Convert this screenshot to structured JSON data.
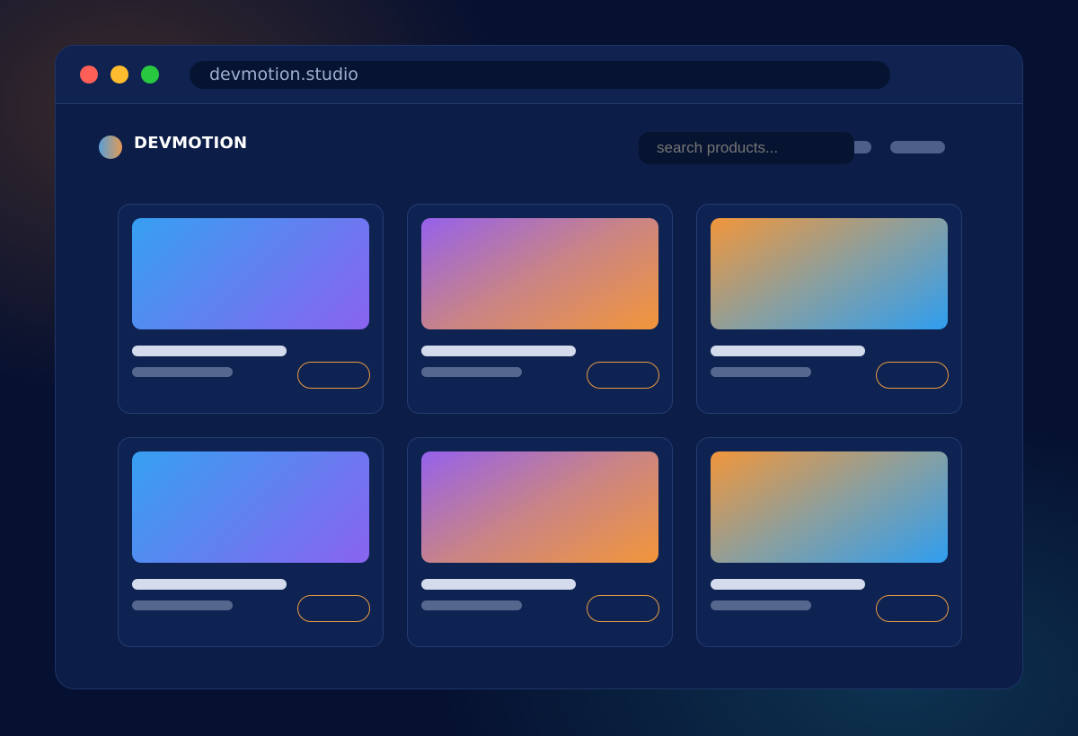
{
  "browser": {
    "url": "devmotion.studio",
    "traffic_lights": {
      "close": "#ff5f57",
      "minimize": "#febc2e",
      "maximize": "#28c840"
    }
  },
  "header": {
    "brand": "DEVMOTION",
    "search_placeholder": "search products..."
  },
  "colors": {
    "accent": "#e89a42",
    "background": "#061030",
    "window": "#0c1d48",
    "card": "#0f2352"
  },
  "products": [
    {
      "thumbnail": "blue-to-violet gradient"
    },
    {
      "thumbnail": "violet-to-orange gradient"
    },
    {
      "thumbnail": "orange-to-blue gradient"
    },
    {
      "thumbnail": "blue-to-violet gradient"
    },
    {
      "thumbnail": "violet-to-orange gradient"
    },
    {
      "thumbnail": "orange-to-blue gradient"
    }
  ]
}
